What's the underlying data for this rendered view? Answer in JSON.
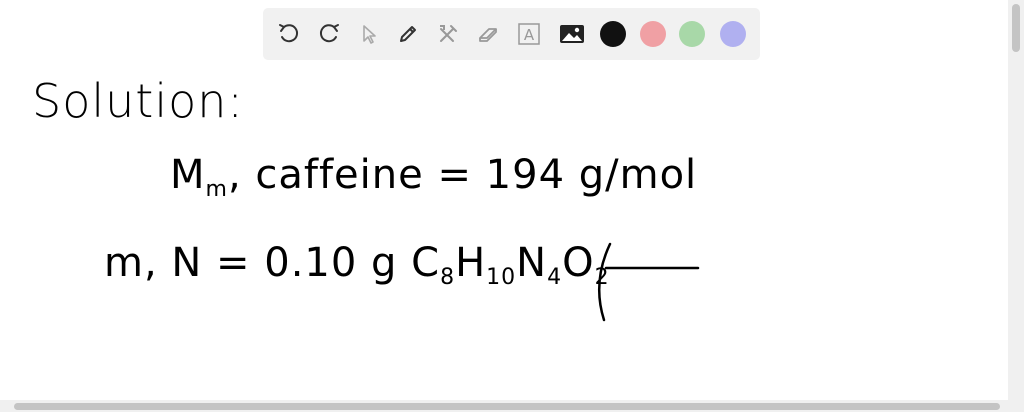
{
  "toolbar": {
    "tools": [
      {
        "name": "undo-icon"
      },
      {
        "name": "redo-icon"
      },
      {
        "name": "select-pointer-icon"
      },
      {
        "name": "pen-icon"
      },
      {
        "name": "tools-icon"
      },
      {
        "name": "eraser-icon"
      },
      {
        "name": "text-box-icon",
        "glyph": "A"
      },
      {
        "name": "image-icon"
      }
    ],
    "colors": [
      "#111111",
      "#f0a0a4",
      "#a8d8a8",
      "#b0b0f0"
    ]
  },
  "board": {
    "line1": "Solution:",
    "line2_a": "M",
    "line2_sub": "m",
    "line2_b": ", caffeine = 194 g/mol",
    "line3_a": "m, N = 0.10 g C",
    "sub_8": "8",
    "h_part": "H",
    "sub_10": "10",
    "n_part": "N",
    "sub_4": "4",
    "o_part": "O",
    "sub_2": "2",
    "paren": "("
  }
}
